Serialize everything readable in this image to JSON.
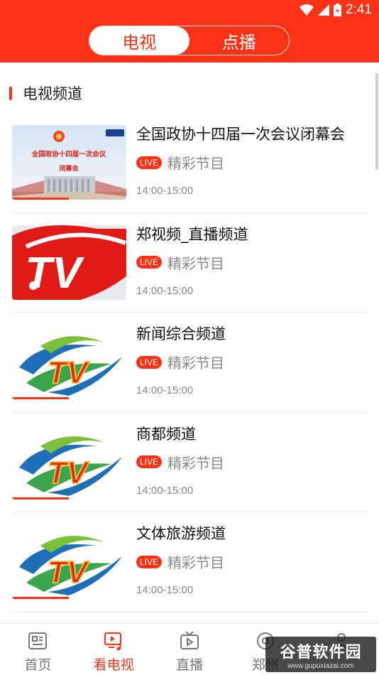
{
  "status": {
    "time": "2:41"
  },
  "segment": {
    "tabs": [
      {
        "label": "电视",
        "active": true
      },
      {
        "label": "点播",
        "active": false
      }
    ]
  },
  "section": {
    "title": "电视频道"
  },
  "channels": [
    {
      "name": "全国政协十四届一次会议闭幕会",
      "live_badge": "LIVE",
      "program": "精彩节目",
      "time": "14:00-15:00",
      "thumb": "conference-thumb",
      "thumb_caption": "全国政协十四届一次会议",
      "thumb_sub": "闭幕会"
    },
    {
      "name": "郑视频_直播频道",
      "live_badge": "LIVE",
      "program": "精彩节目",
      "time": "14:00-15:00",
      "thumb": "red-tv-logo"
    },
    {
      "name": "新闻综合频道",
      "live_badge": "LIVE",
      "program": "精彩节目",
      "time": "14:00-15:00",
      "thumb": "tv-swoosh-logo"
    },
    {
      "name": "商都频道",
      "live_badge": "LIVE",
      "program": "精彩节目",
      "time": "14:00-15:00",
      "thumb": "tv-swoosh-logo"
    },
    {
      "name": "文体旅游频道",
      "live_badge": "LIVE",
      "program": "精彩节目",
      "time": "14:00-15:00",
      "thumb": "tv-swoosh-logo"
    }
  ],
  "tabbar": {
    "items": [
      {
        "label": "首页",
        "icon": "news-icon",
        "active": false
      },
      {
        "label": "看电视",
        "icon": "tv-music-icon",
        "active": true
      },
      {
        "label": "直播",
        "icon": "live-tv-icon",
        "active": false
      },
      {
        "label": "郑州",
        "icon": "radio-icon",
        "active": false
      },
      {
        "label": "",
        "icon": "user-icon",
        "active": false
      }
    ]
  },
  "watermark": {
    "cn": "谷普软件园",
    "en": "www.gupuxiazai.com"
  },
  "colors": {
    "accent": "#fb3215"
  }
}
